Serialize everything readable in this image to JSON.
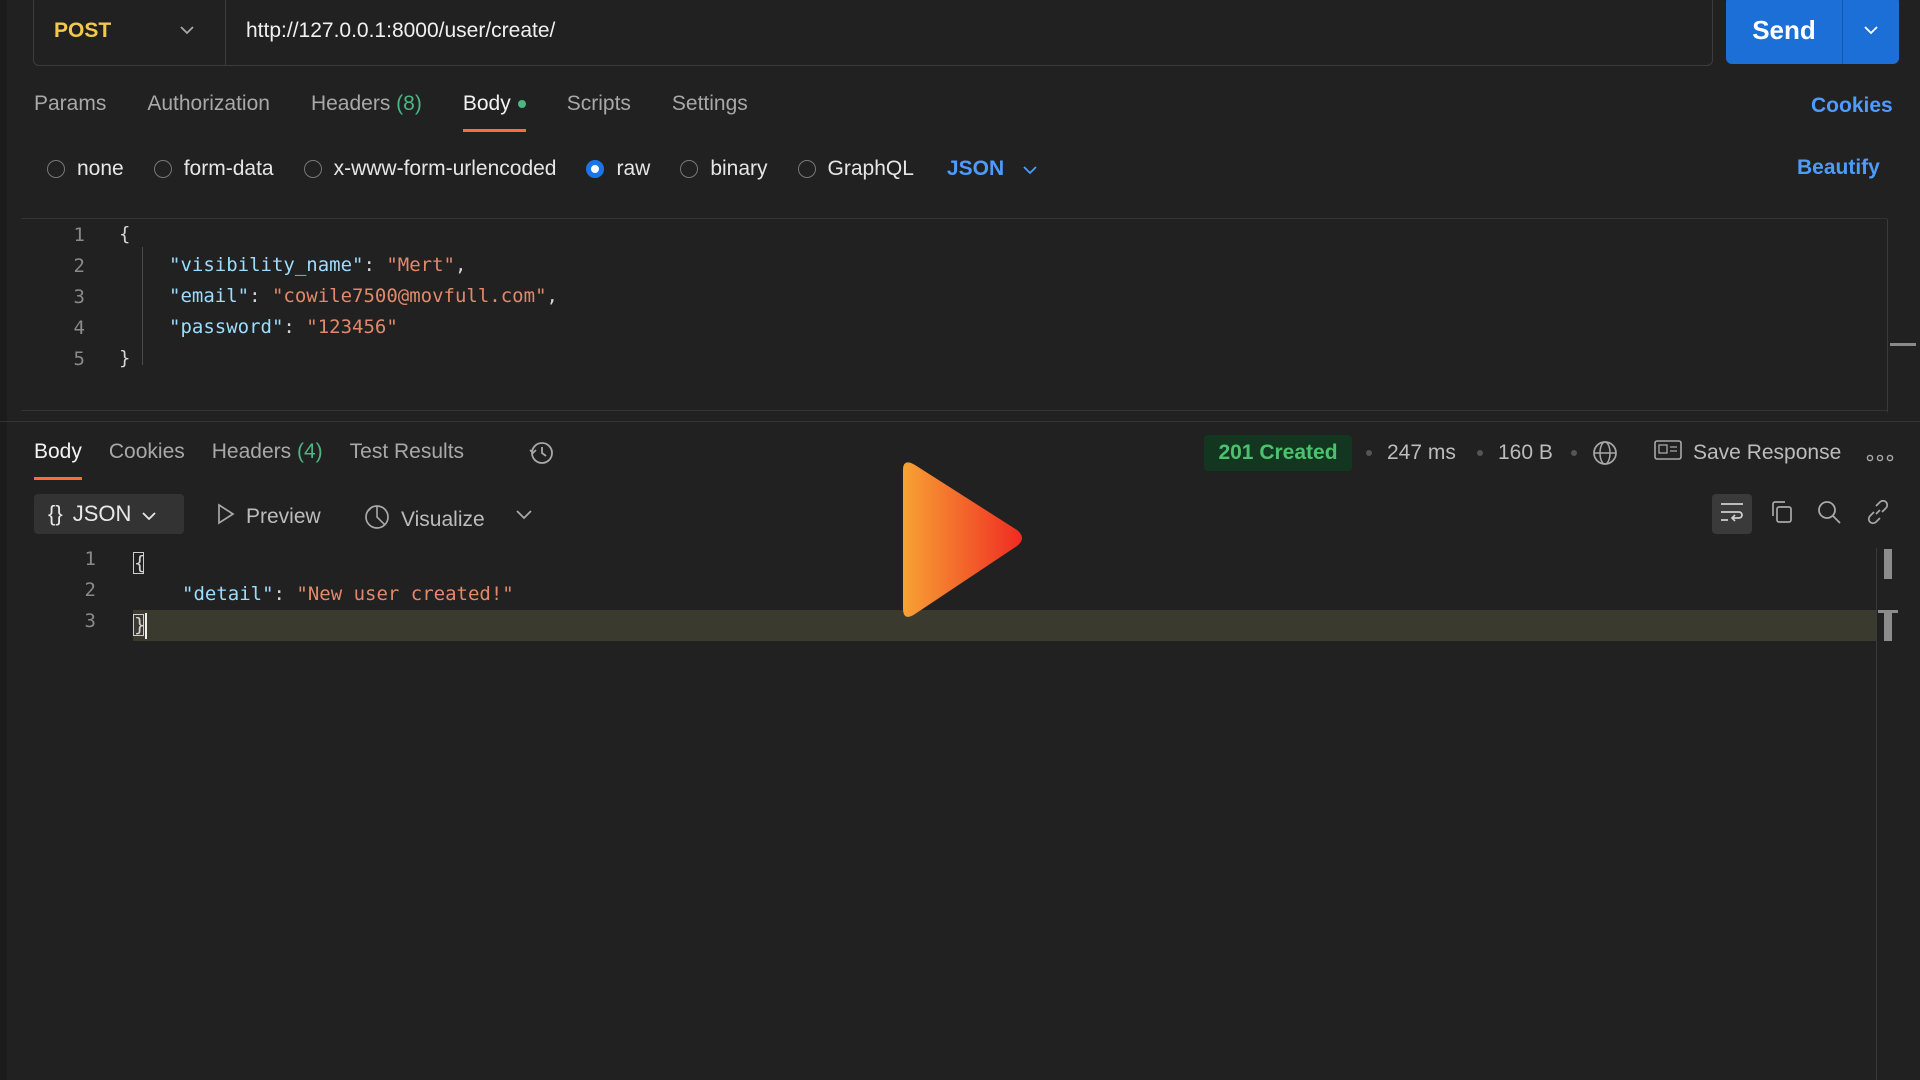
{
  "request": {
    "method": "POST",
    "url": "http://127.0.0.1:8000/user/create/",
    "send_label": "Send"
  },
  "req_tabs": [
    {
      "label": "Params"
    },
    {
      "label": "Authorization"
    },
    {
      "label": "Headers",
      "count": "(8)"
    },
    {
      "label": "Body"
    },
    {
      "label": "Scripts"
    },
    {
      "label": "Settings"
    }
  ],
  "cookies_label": "Cookies",
  "body_types": {
    "options": [
      "none",
      "form-data",
      "x-www-form-urlencoded",
      "raw",
      "binary",
      "GraphQL"
    ],
    "selected": "raw",
    "format": "JSON",
    "beautify_label": "Beautify"
  },
  "request_body": {
    "line_numbers": [
      "1",
      "2",
      "3",
      "4",
      "5"
    ],
    "open": "{",
    "close": "}",
    "fields": [
      {
        "key": "\"visibility_name\"",
        "value": "\"Mert\"",
        "trail": ","
      },
      {
        "key": "\"email\"",
        "value": "\"cowile7500@movfull.com\"",
        "trail": ","
      },
      {
        "key": "\"password\"",
        "value": "\"123456\"",
        "trail": ""
      }
    ]
  },
  "res_tabs": [
    {
      "label": "Body"
    },
    {
      "label": "Cookies"
    },
    {
      "label": "Headers",
      "count": "(4)"
    },
    {
      "label": "Test Results"
    }
  ],
  "response_meta": {
    "status": "201 Created",
    "time": "247 ms",
    "size": "160 B",
    "save_label": "Save Response"
  },
  "response_toolbar": {
    "view_braces": "{}",
    "view_label": "JSON",
    "preview_label": "Preview",
    "visualize_label": "Visualize"
  },
  "response_body": {
    "line_numbers": [
      "1",
      "2",
      "3"
    ],
    "open": "{",
    "close": "}",
    "key": "\"detail\"",
    "value": "\"New user created!\""
  },
  "colors": {
    "accent_send": "#1c6fd6",
    "method": "#f2c94c",
    "status_green": "#4cc26e",
    "tab_underline": "#ff6c37",
    "link_blue": "#4d9bff"
  },
  "icons": [
    "chevron-down-icon",
    "history-icon",
    "globe-icon",
    "save-icon",
    "more-icon",
    "preview-icon",
    "visualize-icon",
    "wrap-icon",
    "copy-icon",
    "search-icon",
    "link-icon",
    "play-icon"
  ]
}
